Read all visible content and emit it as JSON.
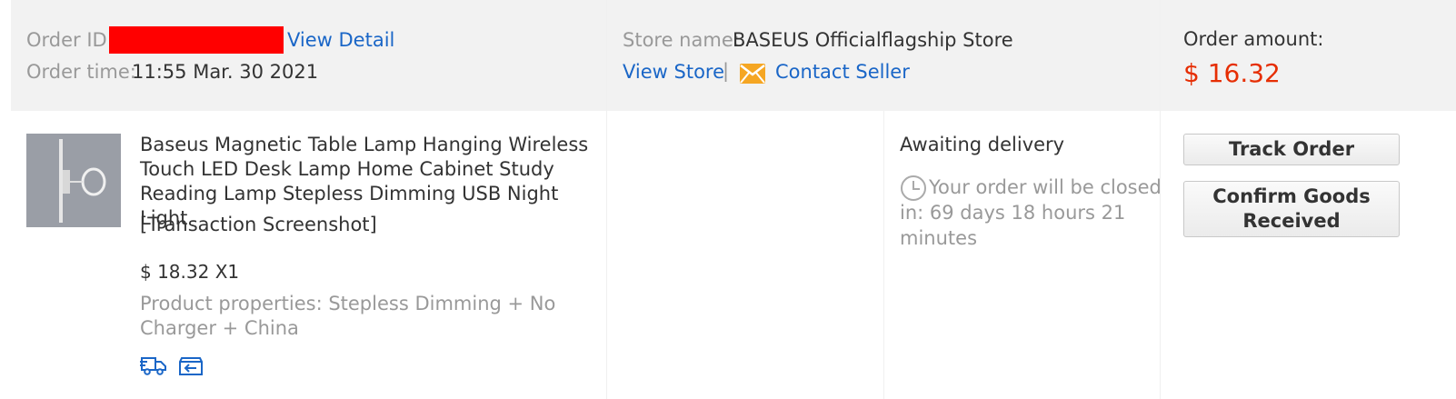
{
  "header": {
    "order_id_label": "Order ID:",
    "view_detail": "View Detail",
    "order_time_label": "Order time:",
    "order_time_value": "11:55 Mar. 30 2021",
    "store_name_label": "Store name:",
    "store_name_value": "BASEUS Officialflagship Store",
    "view_store": "View Store",
    "separator": "|",
    "contact_seller": "Contact Seller",
    "order_amount_label": "Order amount:",
    "order_amount_value": "$ 16.32"
  },
  "product": {
    "title": "Baseus Magnetic Table Lamp Hanging Wireless Touch LED Desk Lamp Home Cabinet Study Reading Lamp Stepless Dimming USB Night Light",
    "snapshot": "[Transaction Screenshot]",
    "price_qty": "$ 18.32 X1",
    "properties": "Product properties: Stepless Dimming + No Charger + China"
  },
  "status": {
    "label": "Awaiting delivery",
    "countdown": "Your order will be closed in: 69 days 18 hours 21 minutes"
  },
  "actions": {
    "track_order": "Track Order",
    "confirm_received": "Confirm Goods Received"
  },
  "icons": {
    "contact": "envelope-icon",
    "clock": "clock-icon",
    "shipping": "truck-icon",
    "return": "return-icon"
  },
  "colors": {
    "link": "#1a66c7",
    "price": "#e62e04",
    "header_bg": "#f2f2f2",
    "envelope": "#f5a623"
  }
}
